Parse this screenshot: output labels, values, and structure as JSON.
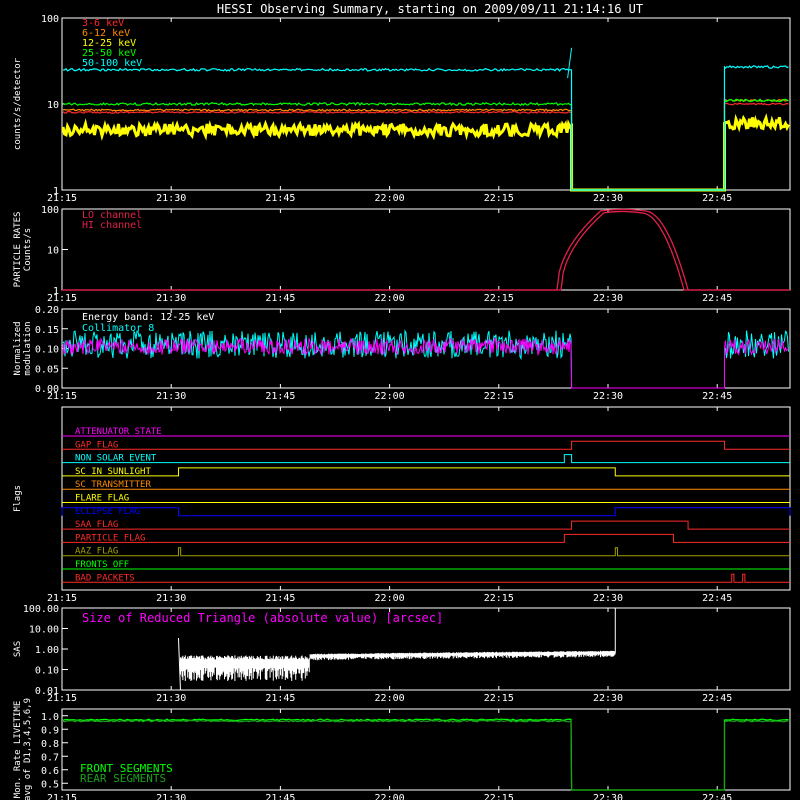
{
  "title": "HESSI Observing Summary, starting on 2009/09/11 21:14:16 UT",
  "time_ticks": [
    "21:15",
    "21:30",
    "21:45",
    "22:00",
    "22:15",
    "22:30",
    "22:45"
  ],
  "colors": {
    "red": "#ff2a2a",
    "orange": "#ff8c00",
    "yellow": "#ffff00",
    "green": "#00ff00",
    "cyan": "#00ffff",
    "magenta": "#ff00ff",
    "blue": "#0000ff",
    "olive": "#a0a000",
    "crimson": "#e0204a",
    "white": "#ffffff",
    "darkgreen": "#1aa01a"
  },
  "chart_data": [
    {
      "type": "line",
      "ylabel": "counts/s/detector",
      "yscale": "log",
      "ylim": [
        1,
        100
      ],
      "ytick_labels": [
        "1",
        "10",
        "100"
      ],
      "xlim": [
        "21:15",
        "22:55"
      ],
      "series": [
        {
          "name": "3-6 keV",
          "color": "#ff2a2a",
          "level": 8,
          "gap": [
            "22:25",
            "22:46"
          ],
          "after": 10
        },
        {
          "name": "6-12 keV",
          "color": "#ff8c00",
          "level": 8.5,
          "gap": [
            "22:25",
            "22:46"
          ],
          "after": 11
        },
        {
          "name": "12-25 keV",
          "color": "#ffff00",
          "level": 5,
          "gap": [
            "22:25",
            "22:46"
          ],
          "after": 6
        },
        {
          "name": "25-50 keV",
          "color": "#00ff00",
          "level": 10,
          "gap": [
            "22:25",
            "22:46"
          ],
          "after": 11
        },
        {
          "name": "50-100 keV",
          "color": "#00ffff",
          "level": 25,
          "gap": [
            "22:25",
            "22:46"
          ],
          "after": 27
        }
      ]
    },
    {
      "type": "line",
      "ylabel": "PARTICLE RATES",
      "ylabel2": "Counts/s",
      "yscale": "log",
      "ylim": [
        1,
        100
      ],
      "ytick_labels": [
        "1",
        "10",
        "100"
      ],
      "series": [
        {
          "name": "LO channel",
          "color": "#e0204a",
          "rise": [
            "22:23",
            "22:29"
          ],
          "peak": 90,
          "fall": [
            "22:35",
            "22:41"
          ]
        },
        {
          "name": "HI channel",
          "color": "#e0204a",
          "rise": [
            "22:23",
            "22:29"
          ],
          "peak": 80,
          "fall": [
            "22:35",
            "22:41"
          ]
        }
      ]
    },
    {
      "type": "line",
      "ylabel": "Normalized",
      "ylabel2": "modulation",
      "ylim": [
        0,
        0.2
      ],
      "ytick_labels": [
        "0.00",
        "0.05",
        "0.10",
        "0.15",
        "0.20"
      ],
      "annotation": "Energy band: 12-25 keV",
      "series": [
        {
          "name": "Collimator 8",
          "color": "#00ffff",
          "level": 0.11
        },
        {
          "name": "",
          "color": "#ff00ff",
          "level": 0.105
        }
      ],
      "gap": [
        "22:25",
        "22:46"
      ]
    },
    {
      "type": "flags",
      "ylabel": "Flags",
      "flags": [
        {
          "name": "ATTENUATOR STATE",
          "color": "#ff00ff",
          "on": []
        },
        {
          "name": "GAP FLAG",
          "color": "#ff2a2a",
          "on": [
            [
              "22:25",
              "22:46"
            ]
          ]
        },
        {
          "name": "NON SOLAR EVENT",
          "color": "#00ffff",
          "on": [
            [
              "22:24",
              "22:25"
            ]
          ]
        },
        {
          "name": "SC IN SUNLIGHT",
          "color": "#ffff00",
          "on": [
            [
              "21:31",
              "22:31"
            ]
          ]
        },
        {
          "name": "SC TRANSMITTER",
          "color": "#ff8c00",
          "on": []
        },
        {
          "name": "FLARE FLAG",
          "color": "#ffff00",
          "on": []
        },
        {
          "name": "ECLIPSE FLAG",
          "color": "#0000ff",
          "on": [
            [
              "21:15",
              "21:31"
            ],
            [
              "22:31",
              "22:55"
            ]
          ]
        },
        {
          "name": "SAA FLAG",
          "color": "#ff2a2a",
          "on": [
            [
              "22:25",
              "22:41"
            ]
          ]
        },
        {
          "name": "PARTICLE FLAG",
          "color": "#ff2a2a",
          "on": [
            [
              "22:24",
              "22:39"
            ]
          ]
        },
        {
          "name": "AAZ FLAG",
          "color": "#a0a000",
          "on": [
            [
              "21:31",
              "21:31.3"
            ],
            [
              "22:31",
              "22:31.3"
            ]
          ]
        },
        {
          "name": "FRONTS OFF",
          "color": "#00ff00",
          "on": []
        },
        {
          "name": "BAD PACKETS",
          "color": "#ff2a2a",
          "on": [
            [
              "22:47",
              "22:47.3"
            ],
            [
              "22:48.5",
              "22:48.8"
            ]
          ]
        }
      ]
    },
    {
      "type": "line",
      "ylabel": "SAS",
      "yscale": "log",
      "ylim": [
        0.01,
        100
      ],
      "ytick_labels": [
        "0.01",
        "0.10",
        "1.00",
        "10.00",
        "100.00"
      ],
      "annotation": "Size of Reduced Triangle (absolute value) [arcsec]",
      "series": [
        {
          "name": "",
          "color": "#ffffff",
          "segment": [
            "21:31",
            "22:31"
          ]
        }
      ]
    },
    {
      "type": "line",
      "ylabel": "Mon. Rate LIVETIME",
      "ylabel2": "avg of D1,3,4,5,6,9",
      "ylim": [
        0,
        1
      ],
      "ytick_labels": [
        "0.5",
        "0.6",
        "0.7",
        "0.8",
        "0.9",
        "1.0"
      ],
      "series": [
        {
          "name": "FRONT SEGMENTS",
          "color": "#00ff00",
          "level": 0.97
        },
        {
          "name": "REAR SEGMENTS",
          "color": "#1aa01a",
          "level": 0.96
        }
      ],
      "gap": [
        "22:25",
        "22:46"
      ]
    }
  ]
}
